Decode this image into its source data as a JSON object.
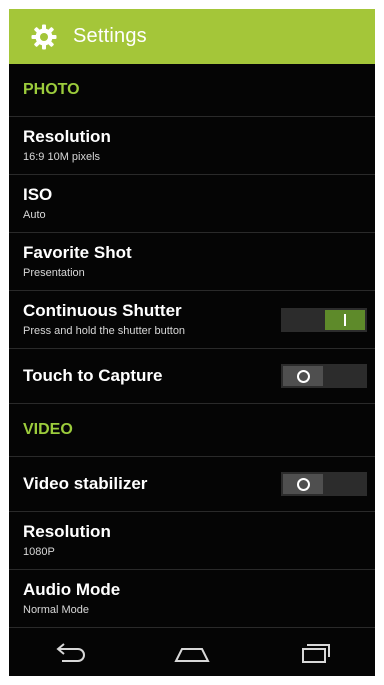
{
  "header": {
    "title": "Settings",
    "icon": "gear-icon",
    "accent_color": "#a4c639"
  },
  "sections": {
    "photo": {
      "label": "PHOTO",
      "items": [
        {
          "title": "Resolution",
          "subtitle": "16:9 10M pixels"
        },
        {
          "title": "ISO",
          "subtitle": "Auto"
        },
        {
          "title": "Favorite Shot",
          "subtitle": "Presentation"
        },
        {
          "title": "Continuous Shutter",
          "subtitle": "Press and hold the shutter button",
          "toggle": "on"
        },
        {
          "title": "Touch to Capture",
          "toggle": "off"
        }
      ]
    },
    "video": {
      "label": "VIDEO",
      "items": [
        {
          "title": "Video stabilizer",
          "toggle": "off"
        },
        {
          "title": "Resolution",
          "subtitle": "1080P"
        },
        {
          "title": "Audio Mode",
          "subtitle": "Normal Mode"
        }
      ]
    }
  },
  "navbar": {
    "back_icon": "back-icon",
    "home_icon": "home-icon",
    "recents_icon": "recent-apps-icon"
  }
}
